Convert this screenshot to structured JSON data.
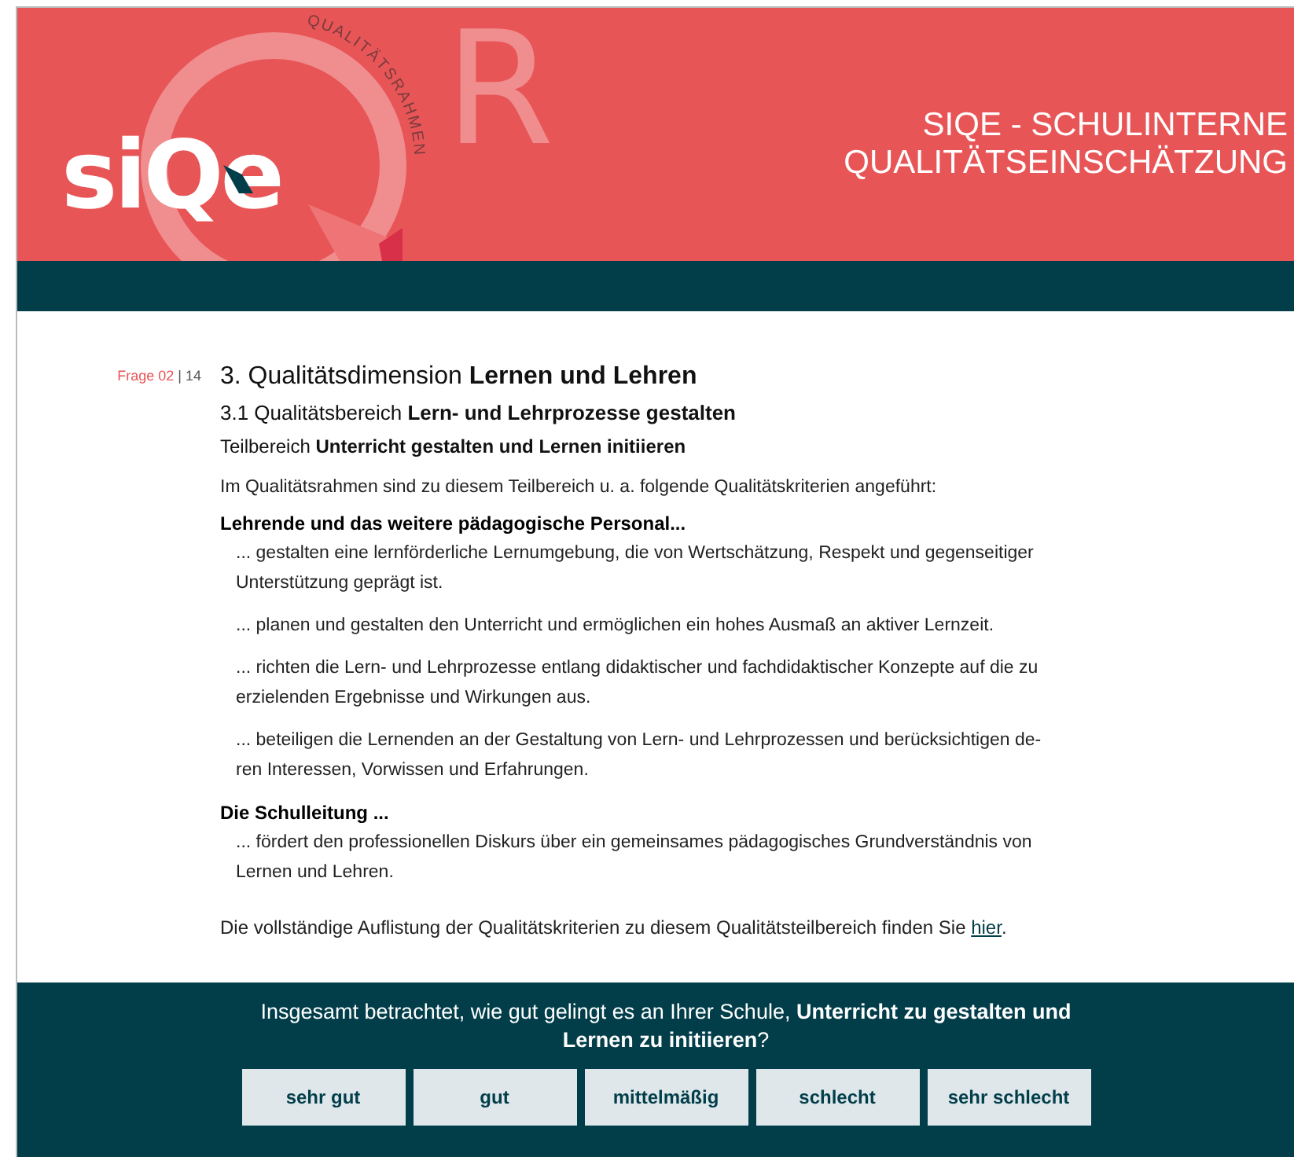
{
  "header": {
    "logo": {
      "wordmark": "siQe",
      "arc_text": "QUALITÄTSRAHMEN",
      "letter": "R"
    },
    "title_lines": [
      "SIQE - SCHULINTERNE",
      "QUALITÄTSEINSCHÄTZUNG"
    ]
  },
  "question_counter": {
    "current": "Frage 02",
    "separator": "|",
    "total": "14"
  },
  "dimension": "3. Qualitätsdimension **Lernen und Lehren**",
  "area": "3.1 Qualitätsbereich **Lern- und Lehrprozesse gestalten**",
  "subarea": "Teilbereich **Unterricht gestalten und Lernen initiieren**",
  "intro": "Im Qualitätsrahmen sind zu diesem Teilbereich u. a. folgende Qualitätskriterien angeführt:",
  "groups": [
    {
      "heading": "Lehrende und das weitere pädagogische Personal...",
      "criteria": [
        {
          "lines": [
            "... gestalten eine lernförderliche Lernumgebung, die von Wertschätzung, Respekt und gegenseitiger",
            "Unterstützung geprägt ist."
          ]
        },
        {
          "lines": [
            "... planen und gestalten den Unterricht und ermöglichen ein hohes Ausmaß an aktiver Lernzeit."
          ]
        },
        {
          "lines": [
            "... richten die Lern- und Lehrprozesse entlang didaktischer und fachdidaktischer Konzepte auf die zu",
            "erzielenden Ergebnisse und Wirkungen aus."
          ]
        },
        {
          "lines": [
            "... beteiligen die Lernenden an der Gestaltung von Lern- und Lehrprozessen und berücksichtigen de-",
            "ren Interessen, Vorwissen und Erfahrungen."
          ]
        }
      ]
    },
    {
      "heading": "Die Schulleitung ...",
      "criteria": [
        {
          "lines": [
            "... fördert den professionellen Diskurs über ein gemeinsames pädagogisches Grundverständnis von",
            "Lernen und Lehren."
          ]
        }
      ]
    }
  ],
  "full_list": {
    "text": "Die vollständige Auflistung der Qualitätskriterien zu diesem Qualitätsteilbereich finden Sie ",
    "link": "hier",
    "end": "."
  },
  "question": "Insgesamt betrachtet, wie gut gelingt es an Ihrer Schule, **Unterricht zu gestalten und Lernen zu initiieren**?",
  "answers": [
    {
      "label": "sehr gut",
      "selected": false
    },
    {
      "label": "gut",
      "selected": false
    },
    {
      "label": "mittelmäßig",
      "selected": false
    },
    {
      "label": "schlecht",
      "selected": false
    },
    {
      "label": "sehr schlecht",
      "selected": false
    }
  ]
}
